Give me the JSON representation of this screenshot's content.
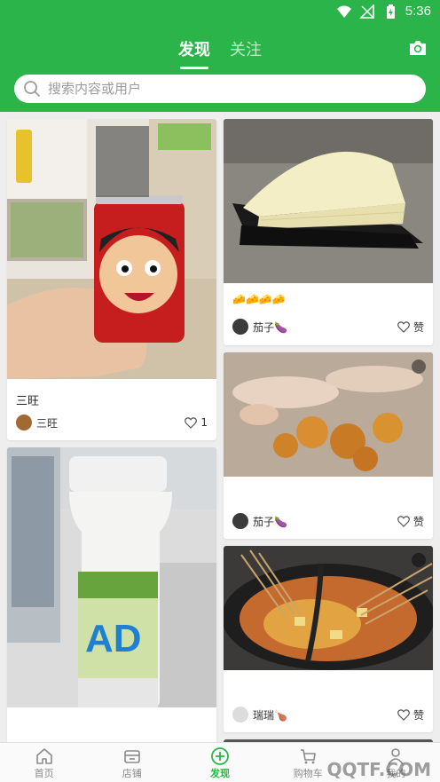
{
  "status_bar": {
    "time": "5:36"
  },
  "header": {
    "tabs": [
      {
        "label": "发现",
        "active": true
      },
      {
        "label": "关注",
        "active": false
      }
    ],
    "camera_icon": "camera-icon"
  },
  "search": {
    "placeholder": "搜索内容或用户"
  },
  "feed": {
    "left": [
      {
        "caption": "三旺",
        "user": "三旺",
        "like_label": "1"
      },
      {
        "caption": "",
        "user": "",
        "like_label": ""
      }
    ],
    "right": [
      {
        "caption": "🧀🧀🧀🧀",
        "user": "茄子🍆",
        "like_label": "赞"
      },
      {
        "caption": "",
        "user": "茄子🍆",
        "like_label": "赞"
      },
      {
        "caption": "",
        "user": "瑞瑞🍗",
        "like_label": "赞"
      }
    ]
  },
  "bottom_nav": [
    {
      "label": "首页",
      "icon": "home-icon",
      "active": false
    },
    {
      "label": "店铺",
      "icon": "store-icon",
      "active": false
    },
    {
      "label": "发现",
      "icon": "plus-circle-icon",
      "active": true
    },
    {
      "label": "购物车",
      "icon": "cart-icon",
      "active": false
    },
    {
      "label": "我的",
      "icon": "user-icon",
      "active": false
    }
  ],
  "watermark": "QQTF.COM",
  "colors": {
    "brand": "#2bb44a"
  }
}
